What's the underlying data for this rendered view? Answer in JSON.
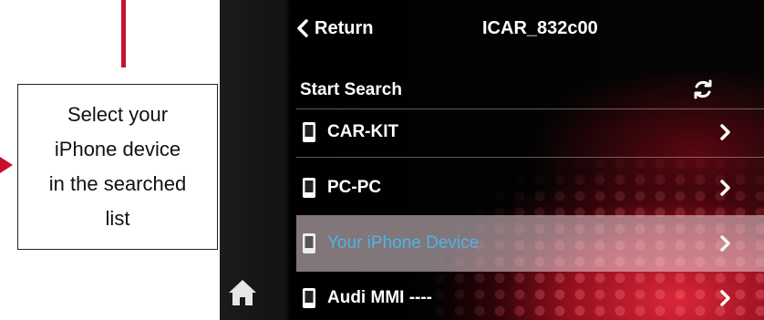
{
  "annotation": {
    "lines": [
      "Select your",
      "iPhone device",
      "in the searched",
      "list"
    ]
  },
  "screen": {
    "header": {
      "return_label": "Return",
      "title": "ICAR_832c00"
    },
    "search": {
      "label": "Start Search",
      "icon": "refresh-icon"
    },
    "devices": [
      {
        "label": "CAR-KIT",
        "icon": "phone-icon"
      },
      {
        "label": "PC-PC",
        "icon": "phone-icon"
      },
      {
        "label": "Your iPhone Device",
        "icon": "phone-icon",
        "highlighted": true
      },
      {
        "label": "Audi MMI ----",
        "icon": "phone-icon"
      }
    ],
    "home_icon": "home-icon"
  },
  "colors": {
    "callout": "#c8102e",
    "highlight_text": "#4fb3e8",
    "highlight_bg": "#ebd7dc"
  }
}
